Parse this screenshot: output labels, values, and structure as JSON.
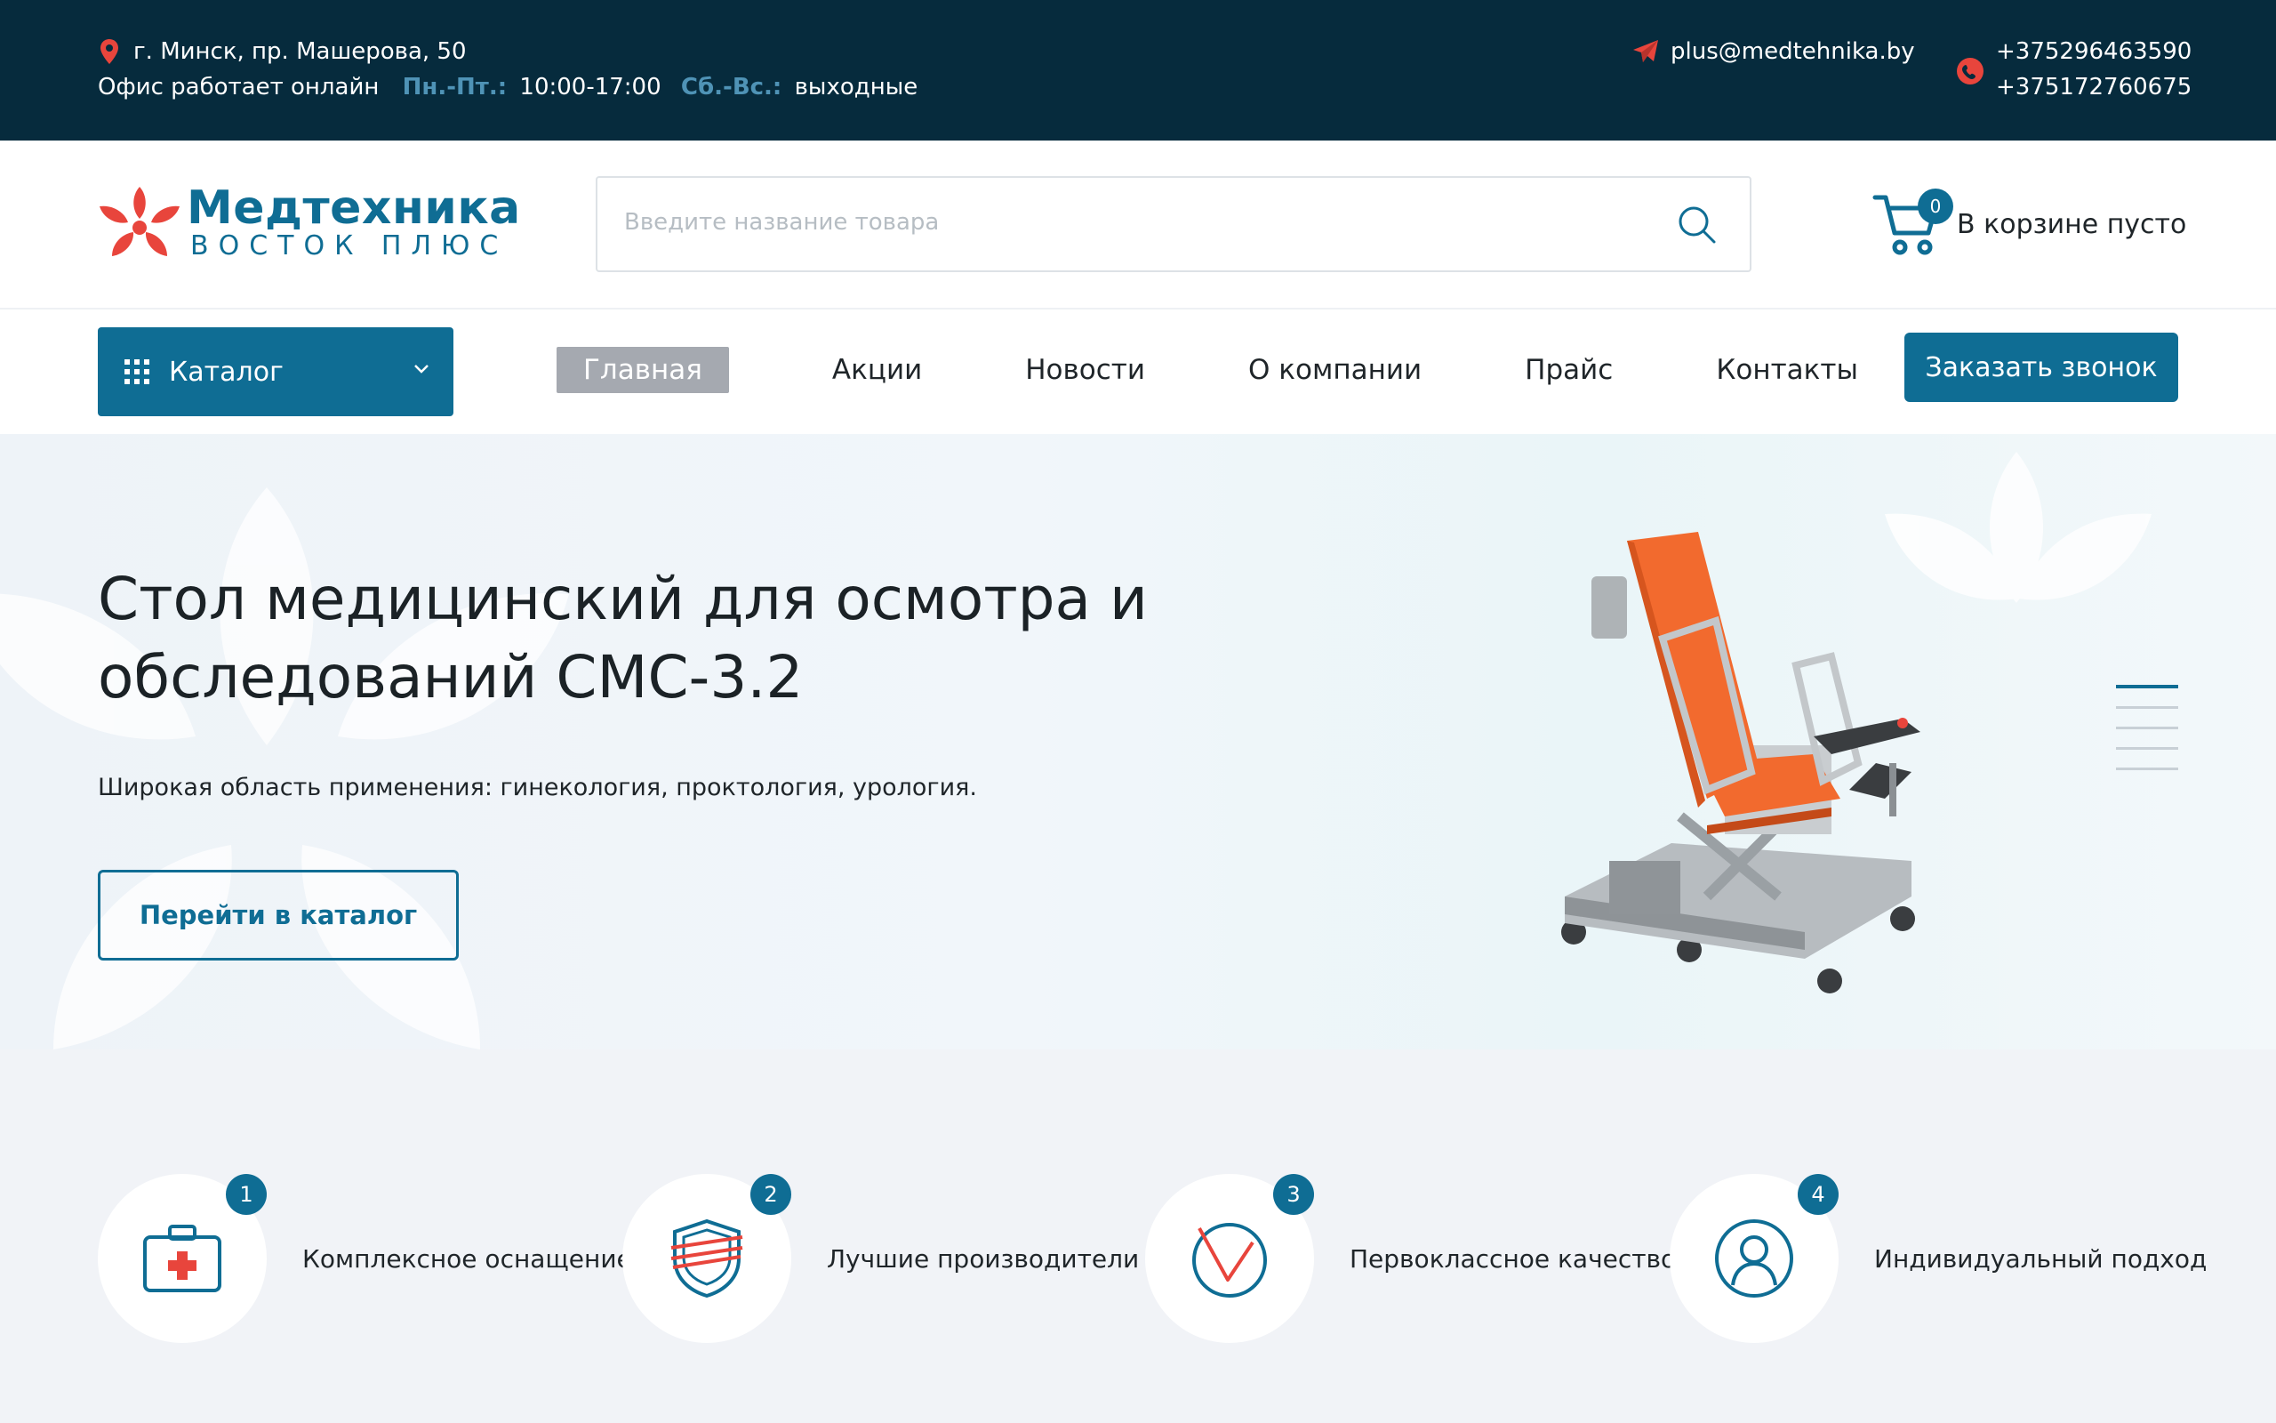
{
  "topbar": {
    "address": "г. Минск, пр. Машерова, 50",
    "office_text": "Офис работает онлайн",
    "weekdays_label": "Пн.-Пт.:",
    "weekdays_hours": "10:00-17:00",
    "weekend_label": "Сб.-Вс.:",
    "weekend_value": "выходные",
    "email": "plus@medtehnika.by",
    "phone1": "+375296463590",
    "phone2": "+375172760675"
  },
  "header": {
    "logo_title": "Медтехника",
    "logo_subtitle": "ВОСТОК ПЛЮС",
    "search_placeholder": "Введите название товара",
    "cart_count": "0",
    "cart_text": "В корзине пусто"
  },
  "nav": {
    "catalog_label": "Каталог",
    "items": [
      {
        "label": "Главная",
        "active": true
      },
      {
        "label": "Акции"
      },
      {
        "label": "Новости"
      },
      {
        "label": "О компании"
      },
      {
        "label": "Прайс"
      },
      {
        "label": "Контакты"
      }
    ],
    "callback_label": "Заказать звонок"
  },
  "hero": {
    "title": "Стол медицинский для осмотра и обследований СМС-3.2",
    "description": "Широкая область применения: гинекология, проктология, урология.",
    "button_label": "Перейти в каталог",
    "active_slide": 1,
    "slide_count": 5
  },
  "features": [
    {
      "number": "1",
      "label": "Комплексное оснащение",
      "icon": "medkit-icon"
    },
    {
      "number": "2",
      "label": "Лучшие производители",
      "icon": "shield-icon"
    },
    {
      "number": "3",
      "label": "Первоклассное качество",
      "icon": "checkmark-icon"
    },
    {
      "number": "4",
      "label": "Индивидуальный подход",
      "icon": "user-icon"
    }
  ],
  "colors": {
    "brand": "#0f6d94",
    "topbar_bg": "#062b3d",
    "accent_red": "#e8453c",
    "seat_orange": "#f26a2e"
  }
}
